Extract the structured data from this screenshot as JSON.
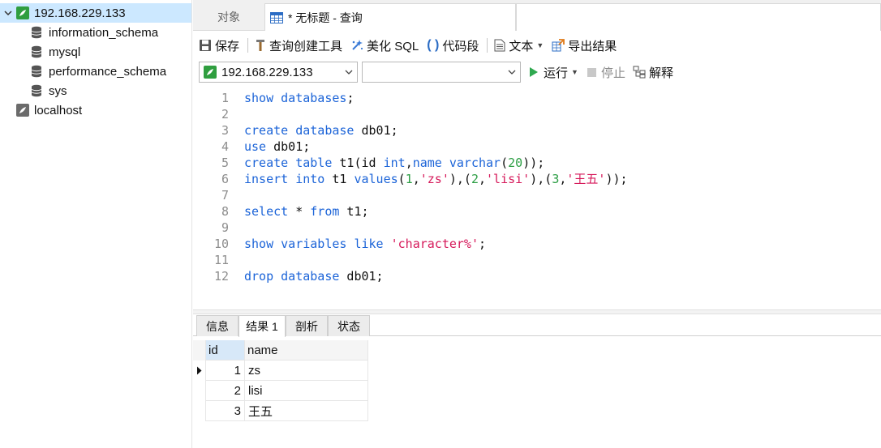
{
  "sidebar": {
    "connections": [
      {
        "label": "192.168.229.133",
        "expanded": true,
        "selected": true,
        "status": "connected",
        "databases": [
          "information_schema",
          "mysql",
          "performance_schema",
          "sys"
        ]
      },
      {
        "label": "localhost",
        "expanded": false,
        "selected": false,
        "status": "disconnected"
      }
    ]
  },
  "tabs": {
    "objects_label": "对象",
    "query_label": "* 无标题 - 查询"
  },
  "toolbar": {
    "save": "保存",
    "query_builder": "查询创建工具",
    "beautify_sql": "美化 SQL",
    "code_snippet": "代码段",
    "text": "文本",
    "export_results": "导出结果"
  },
  "connbar": {
    "connection": "192.168.229.133",
    "database": "",
    "run": "运行",
    "stop": "停止",
    "explain": "解释"
  },
  "editor": {
    "lines": [
      {
        "n": "1",
        "tokens": [
          [
            "kw",
            "show"
          ],
          [
            "p",
            " "
          ],
          [
            "kw",
            "databases"
          ],
          [
            "p",
            ";"
          ]
        ]
      },
      {
        "n": "2",
        "tokens": []
      },
      {
        "n": "3",
        "tokens": [
          [
            "kw",
            "create"
          ],
          [
            "p",
            " "
          ],
          [
            "kw",
            "database"
          ],
          [
            "p",
            " db01;"
          ]
        ]
      },
      {
        "n": "4",
        "tokens": [
          [
            "kw",
            "use"
          ],
          [
            "p",
            " db01;"
          ]
        ]
      },
      {
        "n": "5",
        "tokens": [
          [
            "kw",
            "create"
          ],
          [
            "p",
            " "
          ],
          [
            "kw",
            "table"
          ],
          [
            "p",
            " t1(id "
          ],
          [
            "kw",
            "int"
          ],
          [
            "p",
            ","
          ],
          [
            "kw",
            "name"
          ],
          [
            "p",
            " "
          ],
          [
            "kw",
            "varchar"
          ],
          [
            "p",
            "("
          ],
          [
            "num",
            "20"
          ],
          [
            "p",
            "));"
          ]
        ]
      },
      {
        "n": "6",
        "tokens": [
          [
            "kw",
            "insert"
          ],
          [
            "p",
            " "
          ],
          [
            "kw",
            "into"
          ],
          [
            "p",
            " t1 "
          ],
          [
            "kw",
            "values"
          ],
          [
            "p",
            "("
          ],
          [
            "num",
            "1"
          ],
          [
            "p",
            ","
          ],
          [
            "str",
            "'zs'"
          ],
          [
            "p",
            "),("
          ],
          [
            "num",
            "2"
          ],
          [
            "p",
            ","
          ],
          [
            "str",
            "'lisi'"
          ],
          [
            "p",
            "),("
          ],
          [
            "num",
            "3"
          ],
          [
            "p",
            ","
          ],
          [
            "str",
            "'王五'"
          ],
          [
            "p",
            "));"
          ]
        ]
      },
      {
        "n": "7",
        "tokens": []
      },
      {
        "n": "8",
        "tokens": [
          [
            "kw",
            "select"
          ],
          [
            "p",
            " * "
          ],
          [
            "kw",
            "from"
          ],
          [
            "p",
            " t1;"
          ]
        ]
      },
      {
        "n": "9",
        "tokens": []
      },
      {
        "n": "10",
        "tokens": [
          [
            "kw",
            "show"
          ],
          [
            "p",
            " "
          ],
          [
            "kw",
            "variables"
          ],
          [
            "p",
            " "
          ],
          [
            "kw",
            "like"
          ],
          [
            "p",
            " "
          ],
          [
            "str",
            "'character%'"
          ],
          [
            "p",
            ";"
          ]
        ]
      },
      {
        "n": "11",
        "tokens": []
      },
      {
        "n": "12",
        "tokens": [
          [
            "kw",
            "drop"
          ],
          [
            "p",
            " "
          ],
          [
            "kw",
            "database"
          ],
          [
            "p",
            " db01;"
          ]
        ]
      }
    ]
  },
  "result_tabs": [
    {
      "label": "信息",
      "active": false
    },
    {
      "label": "结果 1",
      "active": true
    },
    {
      "label": "剖析",
      "active": false
    },
    {
      "label": "状态",
      "active": false
    }
  ],
  "grid": {
    "columns": [
      "id",
      "name"
    ],
    "rows": [
      [
        "1",
        "zs"
      ],
      [
        "2",
        "lisi"
      ],
      [
        "3",
        "王五"
      ]
    ]
  },
  "colors": {
    "keyword": "#1c64d8",
    "string": "#d6195a",
    "number": "#2c9e44",
    "selection": "#cce8ff",
    "run": "#2fa84f",
    "connected": "#2f9e3f"
  }
}
